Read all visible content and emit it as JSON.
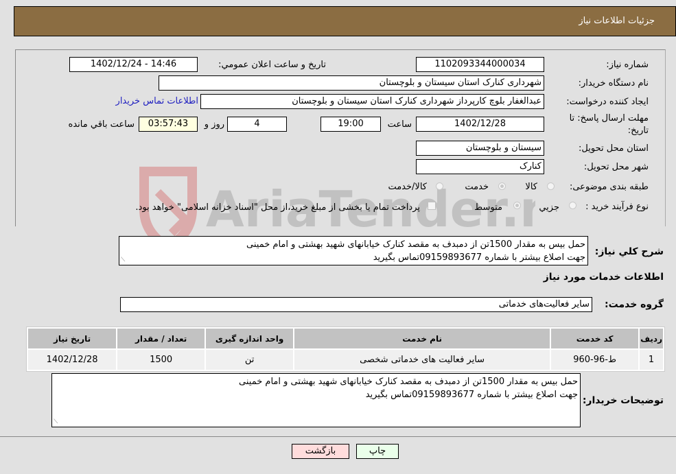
{
  "header": {
    "title": "جزئیات اطلاعات نیاز"
  },
  "fields": {
    "need_number": {
      "label": "شماره نیاز:",
      "value": "1102093344000034"
    },
    "announce": {
      "label": "تاریخ و ساعت اعلان عمومي:",
      "value": "1402/12/24 - 14:46"
    },
    "buyer_org": {
      "label": "نام دستگاه خریدار:",
      "value": "شهرداری کنارک استان سیستان و بلوچستان"
    },
    "creator": {
      "label": "ایجاد کننده درخواست:",
      "value": "عبدالغفار بلوچ کارپرداز شهرداری کنارک استان سیستان و بلوچستان",
      "contact_link": "اطلاعات تماس خریدار"
    },
    "deadline": {
      "label_line1": "مهلت ارسال پاسخ: تا",
      "label_line2": "تاریخ:",
      "date": "1402/12/28",
      "time_label": "ساعت",
      "time": "19:00",
      "days": "4",
      "days_label": "روز و",
      "remaining": "03:57:43",
      "remaining_label": "ساعت باقي مانده"
    },
    "province": {
      "label": "استان محل تحویل:",
      "value": "سیستان و بلوچستان"
    },
    "city": {
      "label": "شهر محل تحویل:",
      "value": "کنارک"
    },
    "category": {
      "label": "طبقه بندی موضوعی:",
      "options": [
        "کالا",
        "خدمت",
        "کالا/خدمت"
      ],
      "selected": "خدمت"
    },
    "process": {
      "label": "نوع فرآیند خرید :",
      "options": [
        "جزيي",
        "متوسط"
      ],
      "selected": "متوسط",
      "treasury_note": "پرداخت تمام یا بخشی از مبلغ خرید،از محل \"اسناد خزانه اسلامی\" خواهد بود."
    }
  },
  "summary": {
    "label": "شرح كلي نياز:",
    "line1": "حمل بیس به مقدار 1500تن از دمبدف به مقصد کنارک خیابانهای شهید بهشتی و امام خمینی",
    "line2": "جهت اصلاع بیشتر با شماره 09159893677تماس بگیرید"
  },
  "services_section": {
    "title": "اطلاعات خدمات مورد نياز"
  },
  "service_group": {
    "label": "گروه خدمت:",
    "value": "سایر فعالیت‌های خدماتی"
  },
  "table": {
    "headers": [
      "ردیف",
      "کد خدمت",
      "نام خدمت",
      "واحد اندازه گیری",
      "تعداد / مقدار",
      "تاریخ نیاز"
    ],
    "rows": [
      [
        "1",
        "ط-96-960",
        "سایر فعالیت های خدماتی شخصی",
        "تن",
        "1500",
        "1402/12/28"
      ]
    ]
  },
  "buyer_notes": {
    "label": "توضیحات خریدار:",
    "line1": "حمل بیس به مقدار 1500تن از دمبدف به مقصد کنارک خیابانهای شهید بهشتی و امام خمینی",
    "line2": "جهت اصلاع بیشتر با شماره 09159893677تماس بگیرید"
  },
  "buttons": {
    "print": "چاپ",
    "back": "بازگشت"
  },
  "colors": {
    "header_bg": "#8b6d42",
    "print_bg": "#eaffea",
    "back_bg": "#ffdcdc"
  },
  "watermark": {
    "text": "AriaTender.neT"
  }
}
